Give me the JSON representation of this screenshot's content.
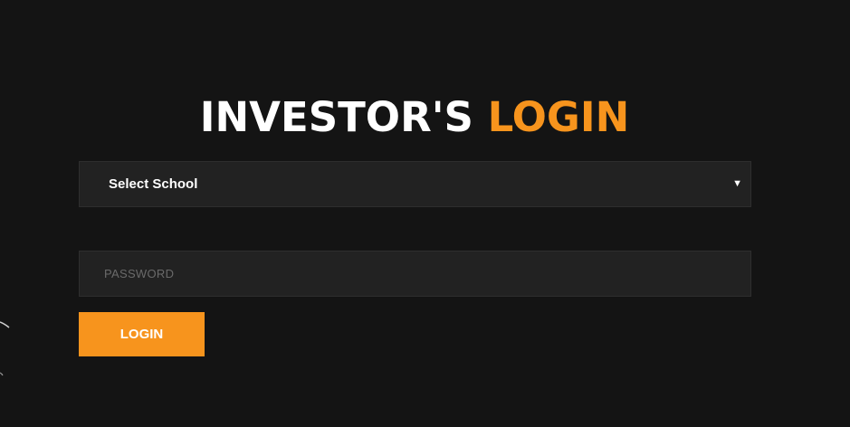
{
  "heading": {
    "part1": "INVESTOR'S ",
    "part2": "LOGIN"
  },
  "school_select": {
    "selected": "Select School"
  },
  "password": {
    "placeholder": "PASSWORD"
  },
  "login_button": {
    "label": "LOGIN"
  },
  "colors": {
    "background": "#141414",
    "field": "#222222",
    "accent": "#f7941d",
    "text": "#ffffff"
  },
  "icons": {
    "select_arrow": "triangle-down-icon"
  }
}
